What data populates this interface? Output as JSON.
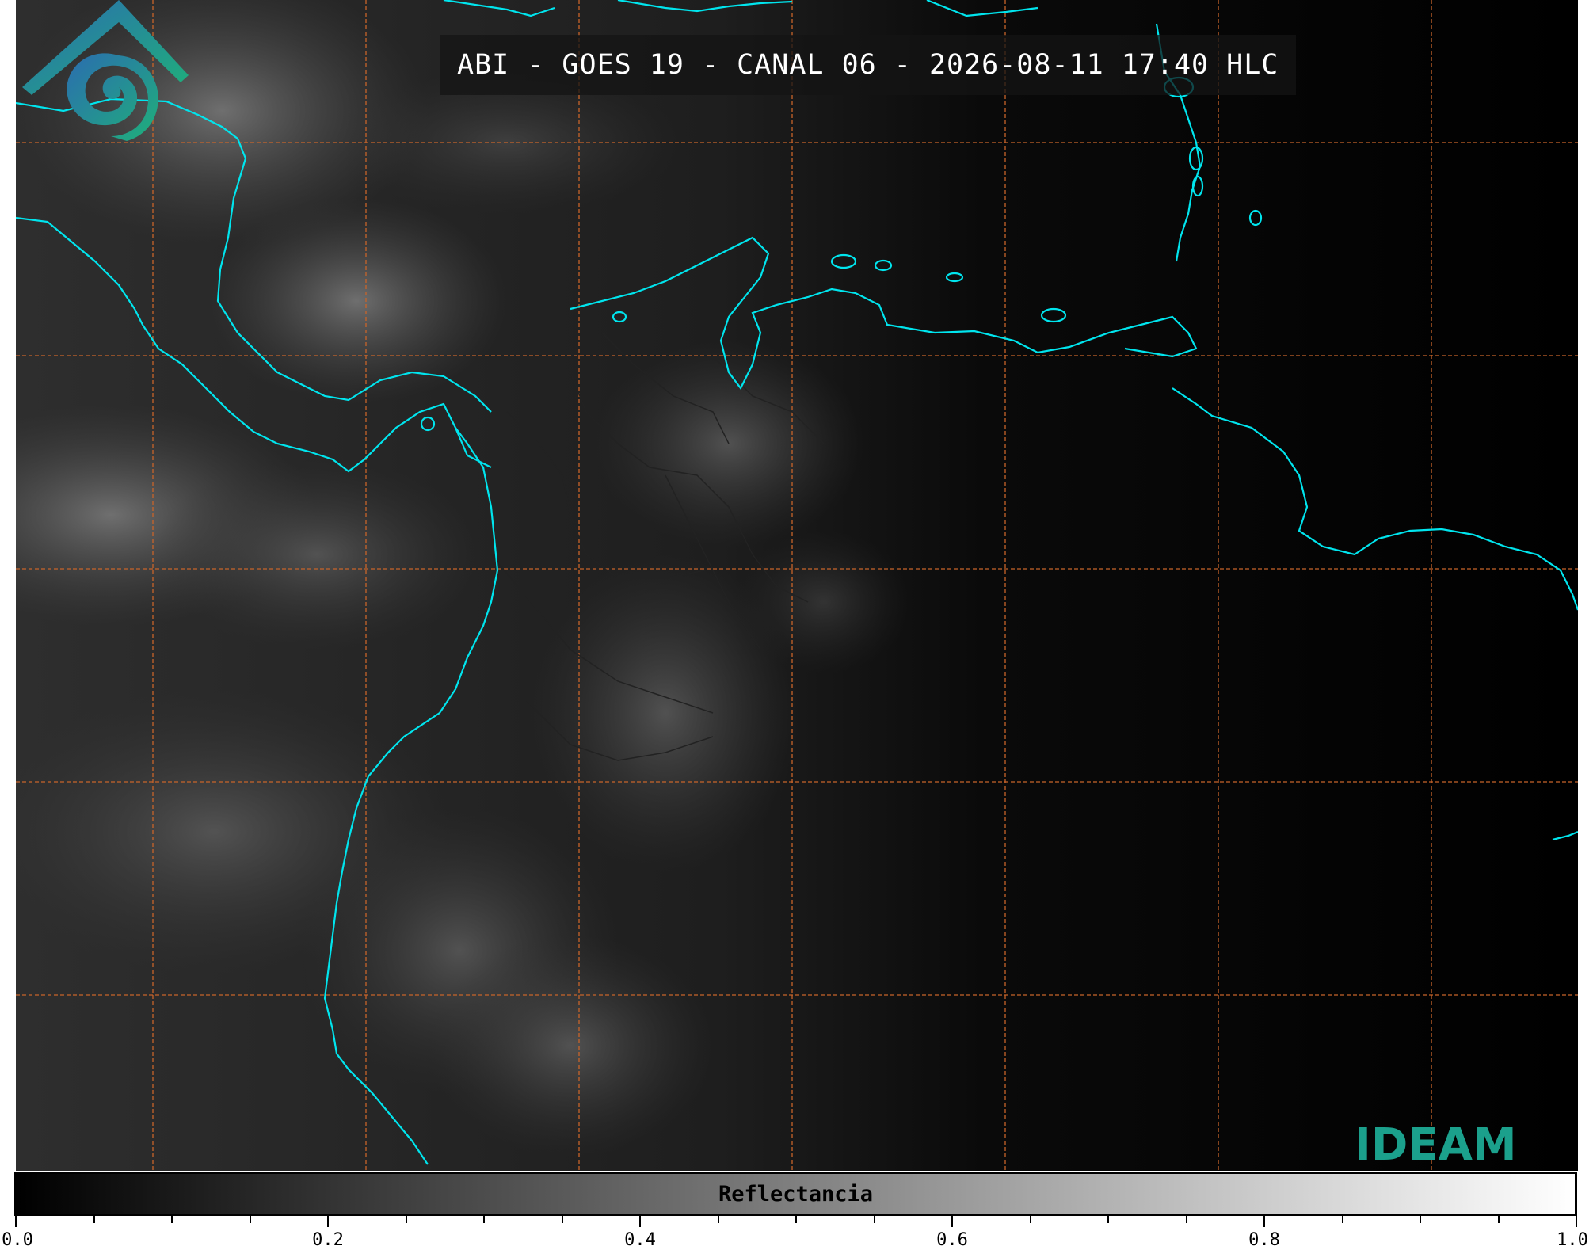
{
  "title": "ABI - GOES 19 - CANAL 06 - 2026-08-11 17:40 HLC",
  "logo": {
    "text": "IDEAM",
    "colors": {
      "gradient_start": "#2b6cb0",
      "gradient_end": "#1fb07a"
    }
  },
  "colorbar": {
    "label": "Reflectancia",
    "min": 0.0,
    "max": 1.0,
    "tick_labels": [
      "0.0",
      "0.2",
      "0.4",
      "0.6",
      "0.8",
      "1.0"
    ],
    "minor_step": 0.05,
    "colors": {
      "low": "#000000",
      "high": "#ffffff"
    }
  },
  "map": {
    "gridlines": {
      "color": "#c8642a",
      "style": "dashed",
      "vertical_count": 7,
      "horizontal_count": 5
    },
    "coastline_color": "#00e5ee",
    "border_color": "#222222"
  }
}
